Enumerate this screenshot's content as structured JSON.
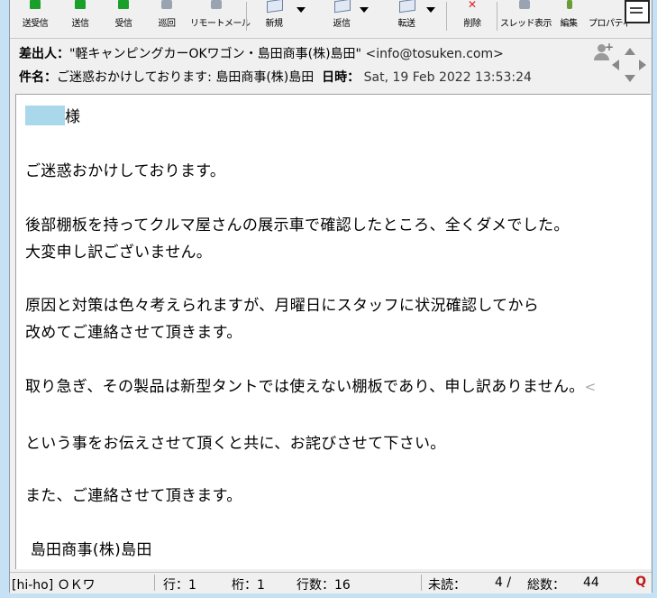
{
  "toolbar": {
    "buttons": [
      {
        "label": "送受信"
      },
      {
        "label": "送信"
      },
      {
        "label": "受信"
      },
      {
        "label": "巡回"
      },
      {
        "label": "リモートメール"
      },
      {
        "label": "新規"
      },
      {
        "label": "返信"
      },
      {
        "label": "転送"
      },
      {
        "label": "削除"
      },
      {
        "label": "スレッド表示"
      },
      {
        "label": "編集"
      },
      {
        "label": "プロパティ"
      }
    ]
  },
  "header": {
    "from_label": "差出人：",
    "from_value": "\"軽キャンピングカーOKワゴン・島田商事(株)島田\"",
    "from_email": "<info@tosuken.com>",
    "subject_label": "件名：",
    "subject_value": "ご迷惑おかけしております: 島田商事(株)島田",
    "date_label": "日時：",
    "date_value": "Sat, 19 Feb 2022 13:53:24"
  },
  "message": {
    "salutation_suffix": "様",
    "lines": [
      "ご迷惑おかけしております。",
      "後部棚板を持ってクルマ屋さんの展示車で確認したところ、全くダメでした。",
      "大変申し訳ございません。",
      "原因と対策は色々考えられますが、月曜日にスタッフに状況確認してから",
      "改めてご連絡させて頂きます。",
      "取り急ぎ、その製品は新型タントでは使えない棚板であり、申し訳ありません。",
      "という事をお伝えさせて頂くと共に、お詫びさせて下さい。",
      "また、ご連絡させて頂きます。",
      " 島田商事(株)島田"
    ],
    "overflow_marker": "<"
  },
  "status": {
    "folder": "[hi-ho] ＯＫワ",
    "row": "行：1",
    "col": "桁：1",
    "line_count": "行数：16",
    "unread_label": "未読：",
    "unread_value": "4 /",
    "total_label": "総数：",
    "total_value": "44",
    "q_icon": "Q"
  },
  "colors": {
    "background": "#c5e1f3",
    "window": "#f0f0f0",
    "name_highlight": "#a8d8ea"
  }
}
